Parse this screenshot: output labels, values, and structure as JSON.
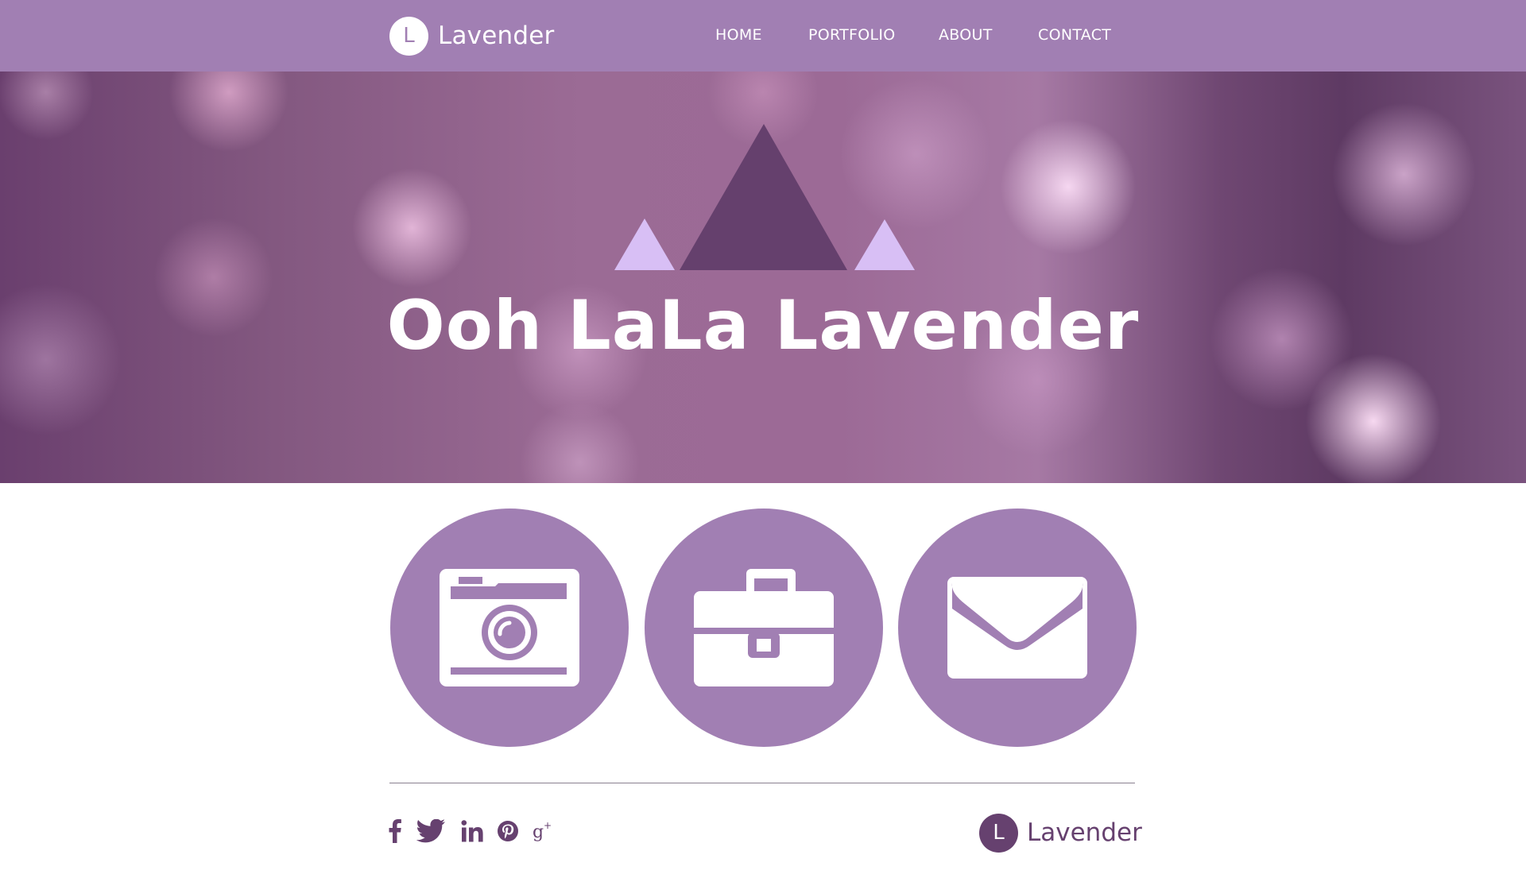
{
  "header": {
    "brand": {
      "badge_letter": "L",
      "name": "Lavender"
    },
    "nav": [
      {
        "label": "HOME"
      },
      {
        "label": "PORTFOLIO"
      },
      {
        "label": "ABOUT"
      },
      {
        "label": "CONTACT"
      }
    ]
  },
  "hero": {
    "title": "Ooh LaLa Lavender",
    "mark_icon": "mountains-logo-icon"
  },
  "features": [
    {
      "icon": "camera-icon"
    },
    {
      "icon": "briefcase-icon"
    },
    {
      "icon": "envelope-icon"
    }
  ],
  "footer": {
    "social": [
      {
        "icon": "facebook-icon"
      },
      {
        "icon": "twitter-icon"
      },
      {
        "icon": "linkedin-icon"
      },
      {
        "icon": "pinterest-icon"
      },
      {
        "icon": "google-plus-icon"
      }
    ],
    "brand": {
      "badge_letter": "L",
      "name": "Lavender"
    }
  },
  "colors": {
    "header_bg": "#a17fb3",
    "feature_circle": "#a17fb3",
    "footer_accent": "#66416f",
    "hero_triangle_dark": "#65406d",
    "hero_triangle_light": "#d8bff5"
  }
}
